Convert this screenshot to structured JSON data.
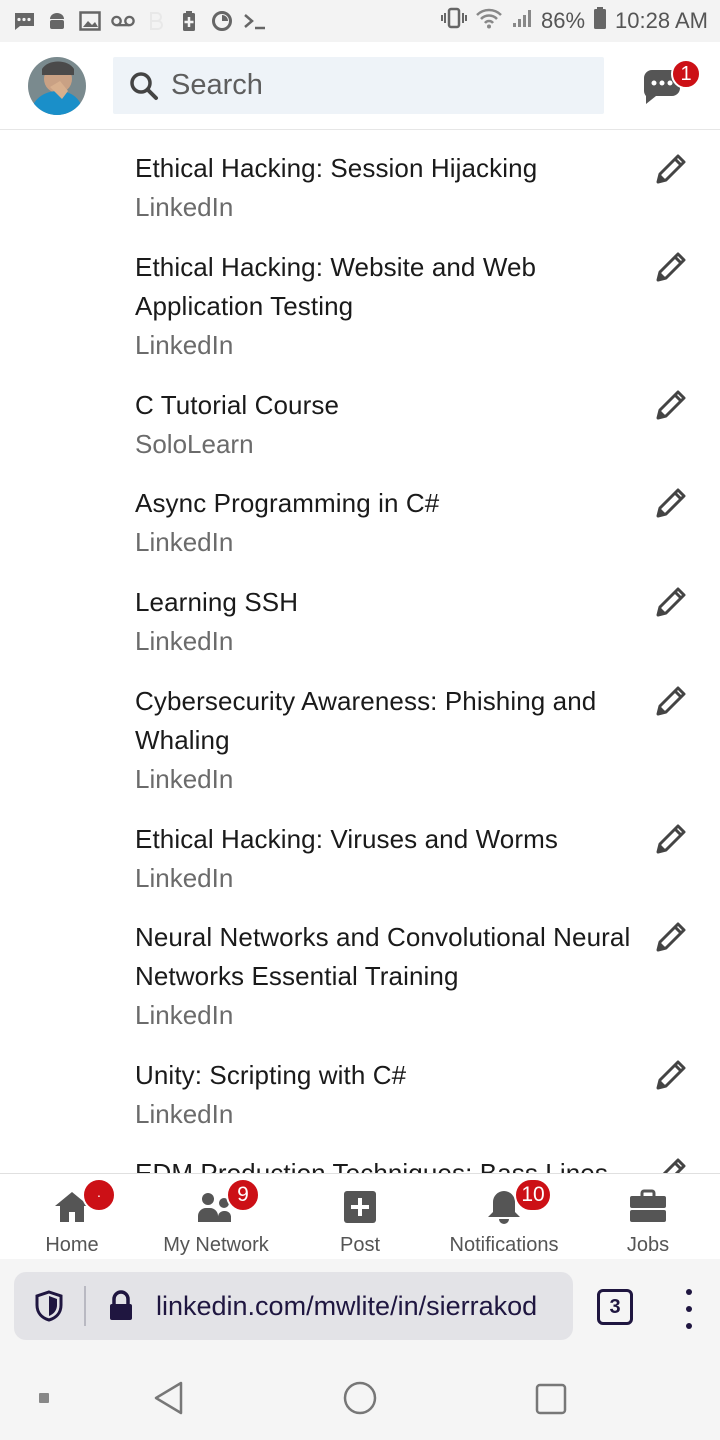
{
  "status_bar": {
    "battery": "86%",
    "time": "10:28 AM"
  },
  "header": {
    "search_placeholder": "Search",
    "messages_badge": "1"
  },
  "courses": [
    {
      "title": "Ethical Hacking: Session Hijacking",
      "org": "LinkedIn"
    },
    {
      "title": "Ethical Hacking: Website and Web Application Testing",
      "org": "LinkedIn"
    },
    {
      "title": "C Tutorial Course",
      "org": "SoloLearn"
    },
    {
      "title": "Async Programming in C#",
      "org": "LinkedIn"
    },
    {
      "title": "Learning SSH",
      "org": "LinkedIn"
    },
    {
      "title": "Cybersecurity Awareness: Phishing and Whaling",
      "org": "LinkedIn"
    },
    {
      "title": "Ethical Hacking: Viruses and Worms",
      "org": "LinkedIn"
    },
    {
      "title": "Neural Networks and Convolutional Neural Networks Essential Training",
      "org": "LinkedIn"
    },
    {
      "title": "Unity: Scripting with C#",
      "org": "LinkedIn"
    },
    {
      "title": "EDM Production Techniques: Bass Lines",
      "org": ""
    }
  ],
  "bottom_nav": {
    "home": "Home",
    "home_badge": "·",
    "my_network": "My Network",
    "my_network_badge": "9",
    "post": "Post",
    "notifications": "Notifications",
    "notifications_badge": "10",
    "jobs": "Jobs"
  },
  "browser": {
    "url": "linkedin.com/mwlite/in/sierrakod",
    "tab_count": "3"
  },
  "colors": {
    "badge": "#cc1016",
    "search_bg": "#eef3f8",
    "browser_ink": "#1f1640"
  }
}
